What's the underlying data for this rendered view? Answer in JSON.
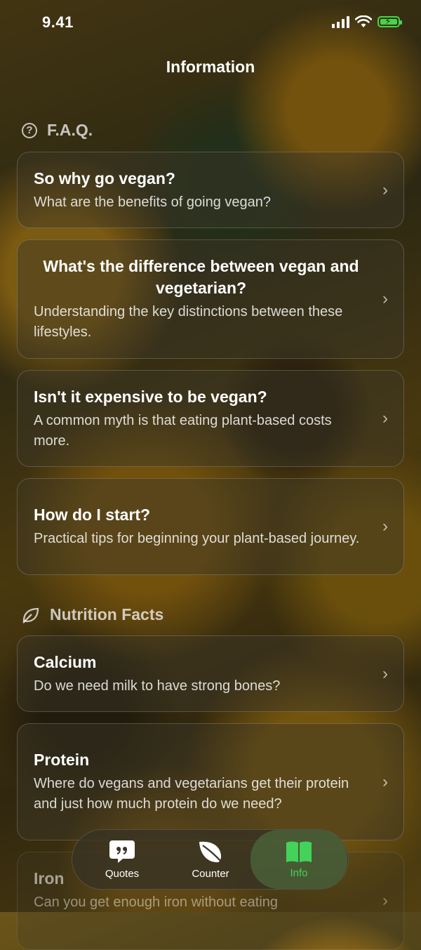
{
  "status_bar": {
    "time": "9.41"
  },
  "nav": {
    "title": "Information"
  },
  "faq": {
    "header": "F.A.Q.",
    "items": [
      {
        "title": "So why go vegan?",
        "subtitle": "What are the benefits of going vegan?"
      },
      {
        "title": "What's the difference between vegan and vegetarian?",
        "subtitle": "Understanding the key distinctions between these lifestyles."
      },
      {
        "title": "Isn't it expensive to be vegan?",
        "subtitle": "A common myth is that eating plant-based costs more."
      },
      {
        "title": "How do I start?",
        "subtitle": "Practical tips for beginning your plant-based journey."
      }
    ]
  },
  "nutrition": {
    "header": "Nutrition Facts",
    "items": [
      {
        "title": "Calcium",
        "subtitle": "Do we need milk to have strong bones?"
      },
      {
        "title": "Protein",
        "subtitle": "Where do vegans and vegetarians get their protein and just how much protein do we need?"
      },
      {
        "title": "Iron",
        "subtitle": "Can you get enough iron without eating"
      }
    ]
  },
  "tabbar": {
    "tabs": [
      {
        "label": "Quotes",
        "icon": "quote-bubble-icon"
      },
      {
        "label": "Counter",
        "icon": "leaf-icon"
      },
      {
        "label": "Info",
        "icon": "book-icon",
        "active": true
      }
    ]
  },
  "colors": {
    "accent": "#44d35a",
    "battery": "#47d34a"
  }
}
